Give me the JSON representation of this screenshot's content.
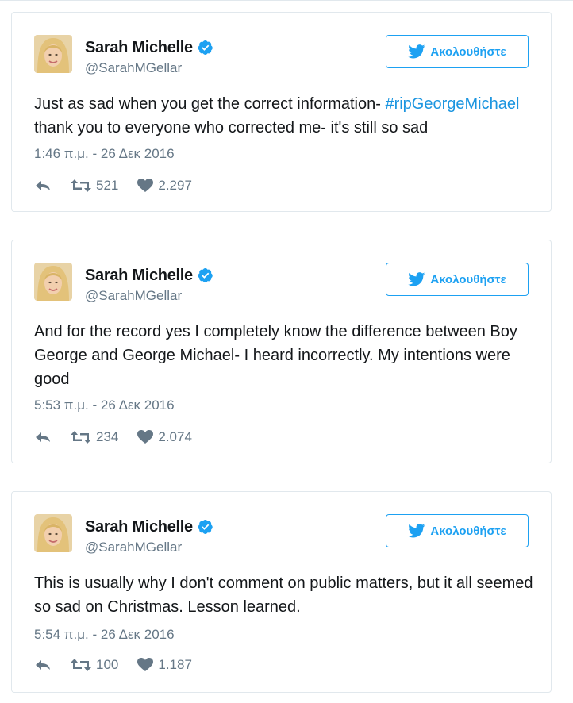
{
  "tweets": [
    {
      "name": "Sarah Michelle",
      "handle": "@SarahMGellar",
      "follow_label": "Ακολουθήστε",
      "text_before": "Just as sad when you get the correct information- ",
      "hashtag": "#ripGeorgeMichael",
      "text_after": "thank you to everyone who corrected me- it's still so sad",
      "timestamp": "1:46 π.μ. - 26 Δεκ 2016",
      "retweets": "521",
      "likes": "2.297"
    },
    {
      "name": "Sarah Michelle",
      "handle": "@SarahMGellar",
      "follow_label": "Ακολουθήστε",
      "text": "And for the record yes I completely know the difference between Boy George and George Michael- I heard incorrectly. My intentions were good",
      "timestamp": "5:53 π.μ. - 26 Δεκ 2016",
      "retweets": "234",
      "likes": "2.074"
    },
    {
      "name": "Sarah Michelle",
      "handle": "@SarahMGellar",
      "follow_label": "Ακολουθήστε",
      "text": "This is usually why I don't comment on public matters, but it all seemed so sad on Christmas. Lesson learned.",
      "timestamp": "5:54 π.μ. - 26 Δεκ 2016",
      "retweets": "100",
      "likes": "1.187"
    }
  ],
  "icons": [
    "reply-icon",
    "retweet-icon",
    "heart-icon",
    "verified-badge-icon",
    "twitter-bird-icon"
  ],
  "colors": {
    "accent": "#1da1f2",
    "hashtag": "#1b95e0",
    "muted": "#657786",
    "text": "#14171a",
    "border": "#e1e8ed"
  }
}
